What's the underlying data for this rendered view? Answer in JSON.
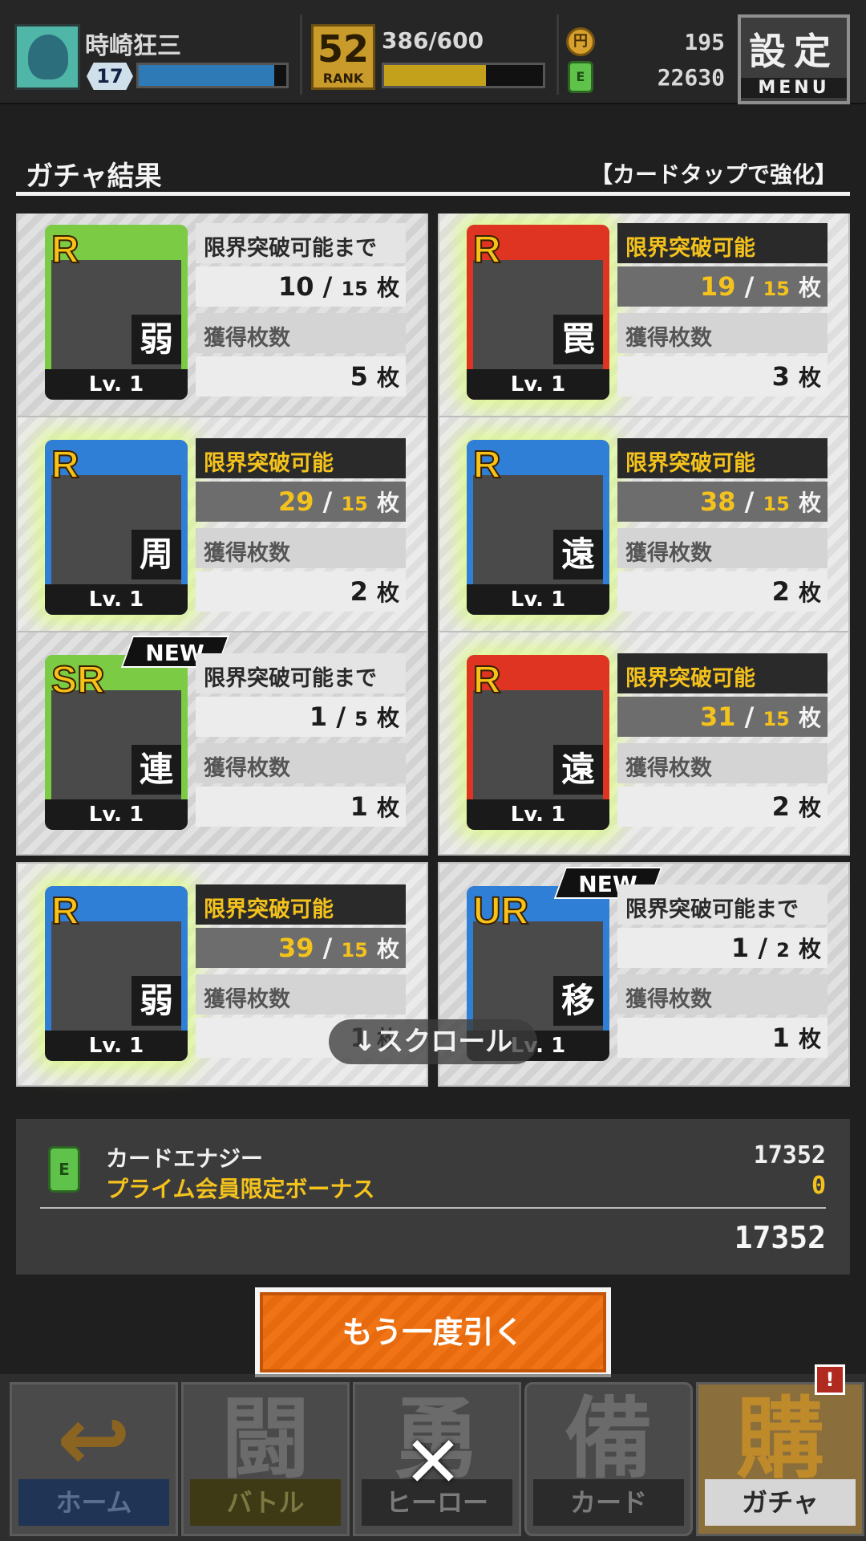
{
  "header": {
    "player_name": "時崎狂三",
    "player_level": "17",
    "xp_fill": 0.92,
    "rank_number": "52",
    "rank_word": "RANK",
    "rank_progress": "386/600",
    "rank_fill": 0.643,
    "coin_icon_label": "円",
    "coins": "195",
    "energy_icon_label": "E",
    "energy": "22630",
    "settings_label": "設定",
    "menu_label": "MENU"
  },
  "section": {
    "title": "ガチャ結果",
    "hint": "【カードタップで強化】"
  },
  "cards": [
    {
      "rarity": "R",
      "type": "弱",
      "level": "Lv. 1",
      "status": "限界突破可能まで",
      "have": "10",
      "need": "15",
      "count_label": "獲得枚数",
      "count": "5",
      "unit": "枚",
      "ready": false,
      "new": false,
      "frame": "g"
    },
    {
      "rarity": "R",
      "type": "罠",
      "level": "Lv. 1",
      "status": "限界突破可能",
      "have": "19",
      "need": "15",
      "count_label": "獲得枚数",
      "count": "3",
      "unit": "枚",
      "ready": true,
      "new": false,
      "frame": "r"
    },
    {
      "rarity": "R",
      "type": "周",
      "level": "Lv. 1",
      "status": "限界突破可能",
      "have": "29",
      "need": "15",
      "count_label": "獲得枚数",
      "count": "2",
      "unit": "枚",
      "ready": true,
      "new": false,
      "frame": "b"
    },
    {
      "rarity": "R",
      "type": "遠",
      "level": "Lv. 1",
      "status": "限界突破可能",
      "have": "38",
      "need": "15",
      "count_label": "獲得枚数",
      "count": "2",
      "unit": "枚",
      "ready": true,
      "new": false,
      "frame": "b"
    },
    {
      "rarity": "SR",
      "type": "連",
      "level": "Lv. 1",
      "status": "限界突破可能まで",
      "have": "1",
      "need": "5",
      "count_label": "獲得枚数",
      "count": "1",
      "unit": "枚",
      "ready": false,
      "new": true,
      "frame": "g"
    },
    {
      "rarity": "R",
      "type": "遠",
      "level": "Lv. 1",
      "status": "限界突破可能",
      "have": "31",
      "need": "15",
      "count_label": "獲得枚数",
      "count": "2",
      "unit": "枚",
      "ready": true,
      "new": false,
      "frame": "r"
    },
    {
      "rarity": "R",
      "type": "弱",
      "level": "Lv. 1",
      "status": "限界突破可能",
      "have": "39",
      "need": "15",
      "count_label": "獲得枚数",
      "count": "1",
      "unit": "枚",
      "ready": true,
      "new": false,
      "frame": "b"
    },
    {
      "rarity": "UR",
      "type": "移",
      "level": "Lv. 1",
      "status": "限界突破可能まで",
      "have": "1",
      "need": "2",
      "count_label": "獲得枚数",
      "count": "1",
      "unit": "枚",
      "ready": false,
      "new": true,
      "frame": "b"
    }
  ],
  "new_label": "NEW",
  "scroll_hint": "↓スクロール",
  "summary": {
    "energy_label": "カードエナジー",
    "energy_value": "17352",
    "bonus_label": "プライム会員限定ボーナス",
    "bonus_value": "0",
    "total": "17352"
  },
  "retry_label": "もう一度引く",
  "nav": [
    {
      "big": "↩",
      "label": "ホーム"
    },
    {
      "big": "闘",
      "label": "バトル"
    },
    {
      "big": "勇",
      "label": "ヒーロー"
    },
    {
      "big": "備",
      "label": "カード"
    },
    {
      "big": "購",
      "label": "ガチャ"
    }
  ],
  "nav_alert": "!",
  "close_symbol": "✕"
}
